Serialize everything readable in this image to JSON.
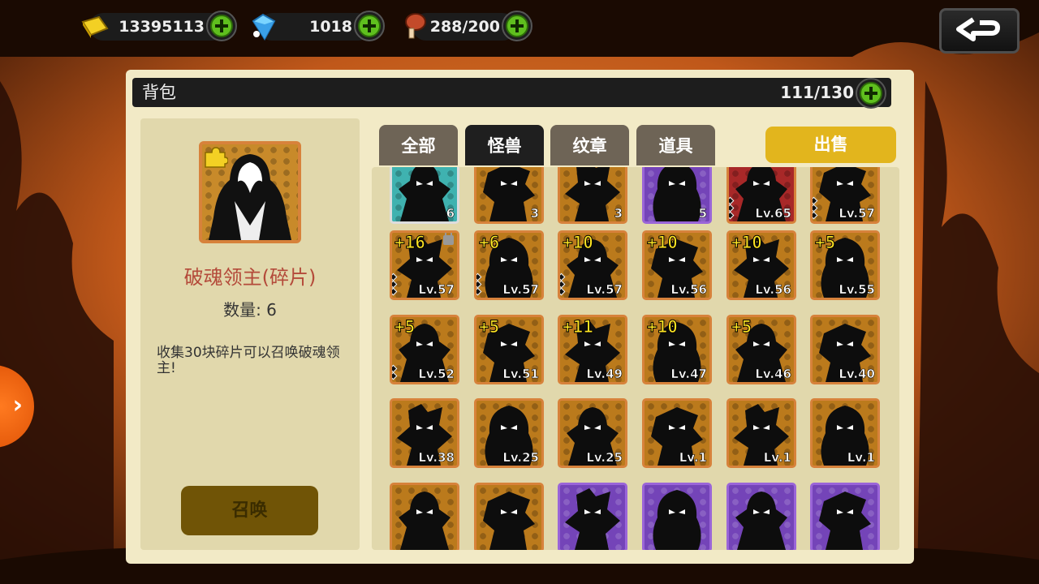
{
  "resources": {
    "gold": {
      "value": "13395113",
      "icon": "gold-bar-icon"
    },
    "gems": {
      "value": "1018",
      "icon": "diamond-icon"
    },
    "stamina": {
      "value": "288/200",
      "icon": "meat-icon"
    }
  },
  "backpack": {
    "title": "背包",
    "capacity": "111/130"
  },
  "selected": {
    "name": "破魂领主(碎片)",
    "quantity_text": "数量: 6",
    "description": "收集30块碎片可以召唤破魂领主!",
    "summon_label": "召唤"
  },
  "tabs": [
    {
      "label": "全部",
      "active": false
    },
    {
      "label": "怪兽",
      "active": true
    },
    {
      "label": "纹章",
      "active": false
    },
    {
      "label": "道具",
      "active": false
    }
  ],
  "sell_label": "出售",
  "items": [
    {
      "plus": "",
      "level": "6",
      "frame": "teal",
      "locked": false,
      "diamonds": 0
    },
    {
      "plus": "",
      "level": "3",
      "frame": "gold",
      "locked": false,
      "diamonds": 0
    },
    {
      "plus": "",
      "level": "3",
      "frame": "gold",
      "locked": false,
      "diamonds": 0
    },
    {
      "plus": "",
      "level": "5",
      "frame": "purple",
      "locked": false,
      "diamonds": 0
    },
    {
      "plus": "",
      "level": "Lv.65",
      "frame": "red",
      "locked": false,
      "diamonds": 3
    },
    {
      "plus": "",
      "level": "Lv.57",
      "frame": "gold",
      "locked": false,
      "diamonds": 3
    },
    {
      "plus": "+16",
      "level": "Lv.57",
      "frame": "gold",
      "locked": true,
      "diamonds": 3
    },
    {
      "plus": "+6",
      "level": "Lv.57",
      "frame": "gold",
      "locked": false,
      "diamonds": 3
    },
    {
      "plus": "+10",
      "level": "Lv.57",
      "frame": "gold",
      "locked": false,
      "diamonds": 3
    },
    {
      "plus": "+10",
      "level": "Lv.56",
      "frame": "gold",
      "locked": false,
      "diamonds": 0
    },
    {
      "plus": "+10",
      "level": "Lv.56",
      "frame": "gold",
      "locked": false,
      "diamonds": 0
    },
    {
      "plus": "+5",
      "level": "Lv.55",
      "frame": "gold",
      "locked": false,
      "diamonds": 0
    },
    {
      "plus": "+5",
      "level": "Lv.52",
      "frame": "gold",
      "locked": false,
      "diamonds": 2
    },
    {
      "plus": "+5",
      "level": "Lv.51",
      "frame": "gold",
      "locked": false,
      "diamonds": 0
    },
    {
      "plus": "+11",
      "level": "Lv.49",
      "frame": "gold",
      "locked": false,
      "diamonds": 0
    },
    {
      "plus": "+10",
      "level": "Lv.47",
      "frame": "gold",
      "locked": false,
      "diamonds": 0
    },
    {
      "plus": "+5",
      "level": "Lv.46",
      "frame": "gold",
      "locked": false,
      "diamonds": 0
    },
    {
      "plus": "",
      "level": "Lv.40",
      "frame": "gold",
      "locked": false,
      "diamonds": 0
    },
    {
      "plus": "",
      "level": "Lv.38",
      "frame": "gold",
      "locked": false,
      "diamonds": 0
    },
    {
      "plus": "",
      "level": "Lv.25",
      "frame": "gold",
      "locked": false,
      "diamonds": 0
    },
    {
      "plus": "",
      "level": "Lv.25",
      "frame": "gold",
      "locked": false,
      "diamonds": 0
    },
    {
      "plus": "",
      "level": "Lv.1",
      "frame": "gold",
      "locked": false,
      "diamonds": 0
    },
    {
      "plus": "",
      "level": "Lv.1",
      "frame": "gold",
      "locked": false,
      "diamonds": 0
    },
    {
      "plus": "",
      "level": "Lv.1",
      "frame": "gold",
      "locked": false,
      "diamonds": 0
    },
    {
      "plus": "",
      "level": "",
      "frame": "gold",
      "locked": false,
      "diamonds": 0
    },
    {
      "plus": "",
      "level": "",
      "frame": "gold",
      "locked": false,
      "diamonds": 0
    },
    {
      "plus": "",
      "level": "",
      "frame": "purple",
      "locked": false,
      "diamonds": 0
    },
    {
      "plus": "",
      "level": "",
      "frame": "purple",
      "locked": false,
      "diamonds": 0
    },
    {
      "plus": "",
      "level": "",
      "frame": "purple",
      "locked": false,
      "diamonds": 0
    },
    {
      "plus": "",
      "level": "",
      "frame": "purple",
      "locked": false,
      "diamonds": 0
    }
  ],
  "colors": {
    "panel": "#f2eac6",
    "gold_frame": "#d7823b",
    "purple_frame": "#9a65d8",
    "plus_text": "#ffe623",
    "sell_button": "#e2b51d",
    "summon_button": "#705406",
    "name_text": "#b44a3a"
  }
}
